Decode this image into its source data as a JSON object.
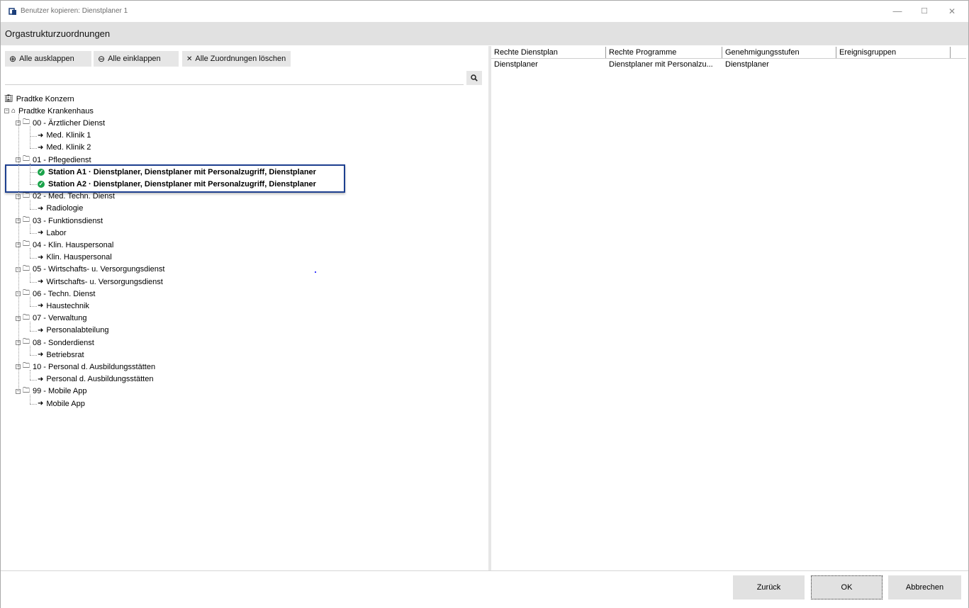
{
  "window": {
    "title": "Benutzer kopieren: Dienstplaner 1",
    "min": "—",
    "max": "☐",
    "close": "✕"
  },
  "header": {
    "title": "Orgastrukturzuordnungen"
  },
  "toolbar": {
    "expand_all": "Alle ausklappen",
    "expand_icon": "⊕",
    "collapse_all": "Alle einklappen",
    "collapse_icon": "⊖",
    "clear_all": "Alle Zuordnungen löschen",
    "clear_icon": "✕"
  },
  "search": {
    "icon": "search-icon"
  },
  "tree": {
    "root": "Pradtke Konzern",
    "hospital": "Pradtke Krankenhaus",
    "groups": [
      {
        "label": "00 - Ärztlicher Dienst",
        "children": [
          "Med. Klinik 1",
          "Med. Klinik 2"
        ]
      },
      {
        "label": "01 - Pflegedienst",
        "children": [
          "Station A1 · Dienstplaner, Dienstplaner mit Personalzugriff, Dienstplaner",
          "Station A2 · Dienstplaner, Dienstplaner mit Personalzugriff, Dienstplaner"
        ]
      },
      {
        "label": "02 - Med. Techn. Dienst",
        "children": [
          "Radiologie"
        ]
      },
      {
        "label": "03 - Funktionsdienst",
        "children": [
          "Labor"
        ]
      },
      {
        "label": "04 - Klin. Hauspersonal",
        "children": [
          "Klin. Hauspersonal"
        ]
      },
      {
        "label": "05 - Wirtschafts- u. Versorgungsdienst",
        "children": [
          "Wirtschafts- u. Versorgungsdienst"
        ]
      },
      {
        "label": "06 - Techn. Dienst",
        "children": [
          "Haustechnik"
        ]
      },
      {
        "label": "07 - Verwaltung",
        "children": [
          "Personalabteilung"
        ]
      },
      {
        "label": "08 - Sonderdienst",
        "children": [
          "Betriebsrat"
        ]
      },
      {
        "label": "10 - Personal d. Ausbildungsstätten",
        "children": [
          "Personal d. Ausbildungsstätten"
        ]
      },
      {
        "label": "99 - Mobile App",
        "children": [
          "Mobile App"
        ]
      }
    ]
  },
  "grid": {
    "columns": [
      "Rechte Dienstplan",
      "Rechte Programme",
      "Genehmigungsstufen",
      "Ereignisgruppen"
    ],
    "rows": [
      [
        "Dienstplaner",
        "Dienstplaner mit Personalzu...",
        "Dienstplaner",
        ""
      ]
    ]
  },
  "footer": {
    "back": "Zurück",
    "ok": "OK",
    "cancel": "Abbrechen"
  },
  "colors": {
    "highlight_border": "#1d3f8f",
    "check_green": "#1aa34a",
    "header_bg": "#e1e1e1"
  }
}
